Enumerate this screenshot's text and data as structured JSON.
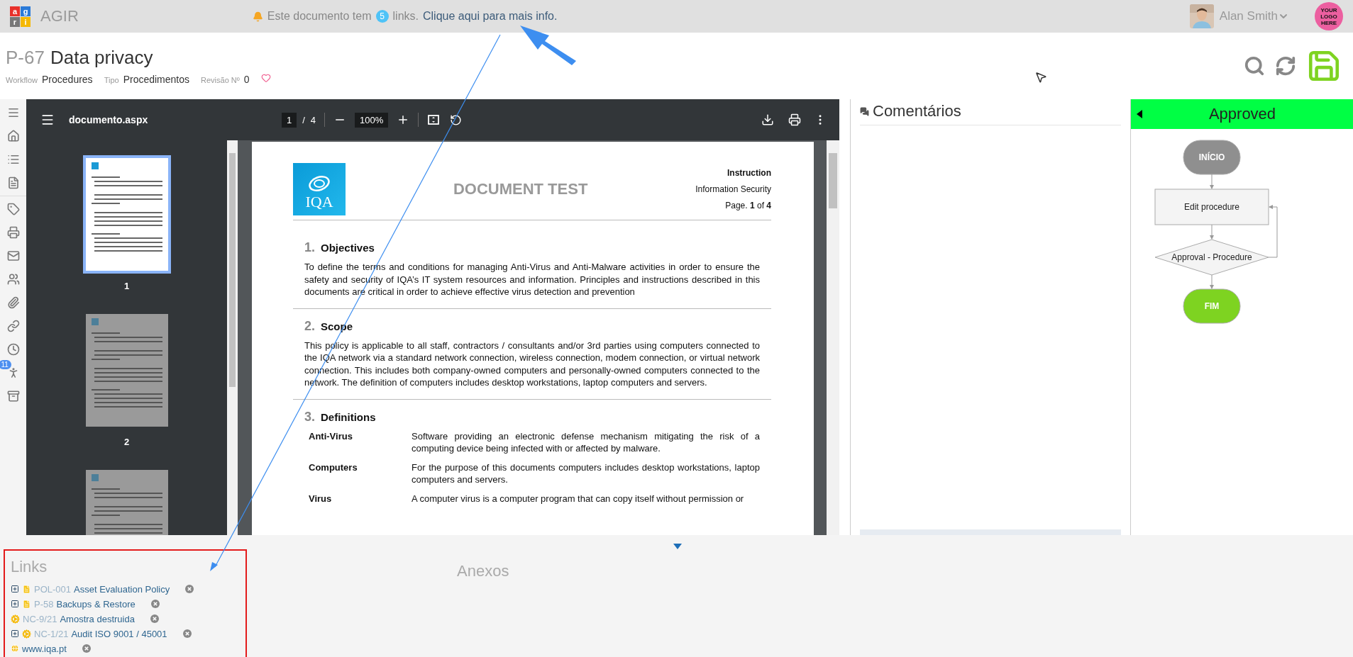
{
  "topbar": {
    "logo_letters": [
      "a",
      "g",
      "r",
      "i"
    ],
    "app_name": "AGIR",
    "notice": {
      "text": "Este documento tem",
      "count": "5",
      "suffix": "links.",
      "link": "Clique aqui para mais info."
    },
    "user": {
      "name": "Alan Smith"
    },
    "company_logo": {
      "text": "YOUR LOGO HERE"
    }
  },
  "document": {
    "code": "P-67",
    "title": "Data privacy",
    "meta": [
      {
        "label": "Workflow",
        "value": "Procedures"
      },
      {
        "label": "Tipo",
        "value": "Procedimentos"
      },
      {
        "label": "Revisão Nº",
        "value": "0"
      }
    ]
  },
  "nav": {
    "badge": "11"
  },
  "viewer": {
    "file_name": "documento.aspx",
    "page": "1",
    "page_sep": "/",
    "page_count": "4",
    "zoom": "100%",
    "thumbnails": [
      {
        "label": "1",
        "selected": true
      },
      {
        "label": "2",
        "selected": false
      },
      {
        "selected": false
      }
    ]
  },
  "page": {
    "logo_text": "IQA",
    "title": "DOCUMENT TEST",
    "header_right": [
      "Instruction",
      "Information Security"
    ],
    "page_label": "Page. **1** of **4**",
    "sections": [
      {
        "number": "1.",
        "heading": "Objectives",
        "body": "To define the terms and conditions for managing Anti-Virus and Anti-Malware activities in order to ensure the safety and security of IQA’s IT system resources and information. Principles and instructions described in this documents are critical in order to achieve effective virus detection and prevention"
      },
      {
        "number": "2.",
        "heading": "Scope",
        "body": "This policy is applicable to all staff, contractors / consultants and/or 3rd parties using computers connected to the IQA network via a standard network connection, wireless connection, modem connection, or virtual network connection. This includes both company-owned computers and personally-owned computers connected to the network. The definition of computers includes desktop workstations, laptop computers and servers."
      },
      {
        "number": "3.",
        "heading": "Definitions",
        "definitions": [
          {
            "term": "Anti-Virus",
            "text": "Software providing an electronic defense mechanism mitigating the risk of a computing device being infected with or affected by malware."
          },
          {
            "term": "Computers",
            "text": "For the purpose of this documents computers includes desktop workstations, laptop computers and servers."
          },
          {
            "term": "Virus",
            "text": "A computer virus is a computer program that can copy itself without permission or"
          }
        ]
      }
    ]
  },
  "comments": {
    "title": "Comentários"
  },
  "workflow": {
    "status": "Approved",
    "nodes": [
      {
        "kind": "terminal",
        "label": "INÍCIO",
        "color": "#8f8f8f"
      },
      {
        "kind": "process",
        "label": "Edit procedure",
        "color": "#f4f4f4"
      },
      {
        "kind": "decision",
        "label": "Approval - Procedure",
        "color": "#f4f4f4"
      },
      {
        "kind": "terminal",
        "label": "FIM",
        "color": "#7ed321"
      }
    ]
  },
  "links": {
    "title": "Links",
    "items": [
      {
        "kind": "document",
        "expandable": true,
        "code": "POL-001",
        "title": "Asset Evaluation Policy"
      },
      {
        "kind": "document",
        "expandable": true,
        "code": "P-58",
        "title": "Backups & Restore"
      },
      {
        "kind": "occurrence",
        "expandable": false,
        "code": "NC-9/21",
        "title": "Amostra destruida"
      },
      {
        "kind": "occurrence",
        "expandable": true,
        "code": "NC-1/21",
        "title": "Audit ISO 9001 / 45001"
      },
      {
        "kind": "web",
        "expandable": false,
        "title": "www.iqa.pt"
      }
    ]
  },
  "attachments": {
    "title": "Anexos"
  }
}
